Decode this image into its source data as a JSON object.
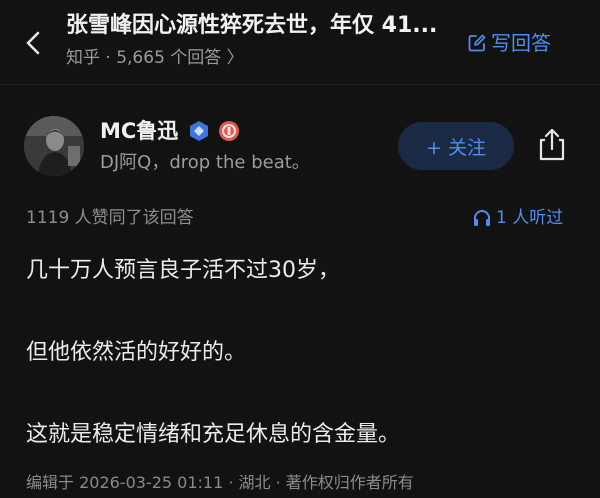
{
  "header": {
    "title": "张雪峰因心源性猝死去世，年仅 41...",
    "subtitle": "知乎 · 5,665 个回答 〉",
    "write_label": "写回答"
  },
  "author": {
    "name": "MC鲁迅",
    "bio": "DJ阿Q，drop the beat。",
    "follow_label": "+ 关注"
  },
  "meta": {
    "likes": "1119 人赞同了该回答",
    "listeners": "1 人听过"
  },
  "content": {
    "paragraphs": [
      "几十万人预言良子活不过30岁，",
      "但他依然活的好好的。",
      "这就是稳定情绪和充足休息的含金量。"
    ]
  },
  "footer": {
    "edit_info": "编辑于 2026-03-25 01:11 · 湖北 · 著作权归作者所有"
  },
  "colors": {
    "background": "#121212",
    "accent": "#4f8df0",
    "follow_bg": "#1b2a44"
  },
  "icons": [
    "back-arrow-icon",
    "edit-icon",
    "verified-badge-icon",
    "medal-badge-icon",
    "share-icon",
    "headphones-icon"
  ]
}
